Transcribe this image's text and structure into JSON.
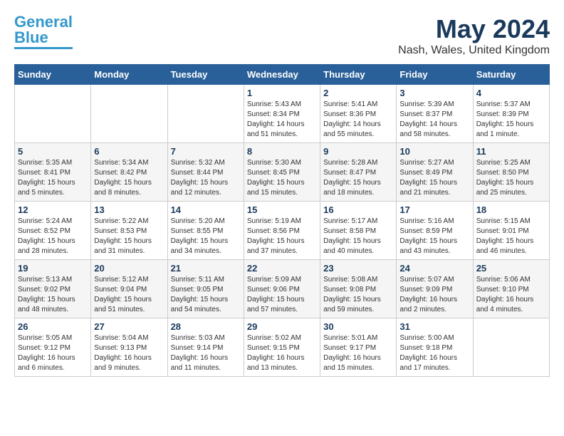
{
  "header": {
    "logo_general": "General",
    "logo_blue": "Blue",
    "month_year": "May 2024",
    "location": "Nash, Wales, United Kingdom"
  },
  "weekdays": [
    "Sunday",
    "Monday",
    "Tuesday",
    "Wednesday",
    "Thursday",
    "Friday",
    "Saturday"
  ],
  "weeks": [
    [
      {
        "day": "",
        "info": ""
      },
      {
        "day": "",
        "info": ""
      },
      {
        "day": "",
        "info": ""
      },
      {
        "day": "1",
        "info": "Sunrise: 5:43 AM\nSunset: 8:34 PM\nDaylight: 14 hours\nand 51 minutes."
      },
      {
        "day": "2",
        "info": "Sunrise: 5:41 AM\nSunset: 8:36 PM\nDaylight: 14 hours\nand 55 minutes."
      },
      {
        "day": "3",
        "info": "Sunrise: 5:39 AM\nSunset: 8:37 PM\nDaylight: 14 hours\nand 58 minutes."
      },
      {
        "day": "4",
        "info": "Sunrise: 5:37 AM\nSunset: 8:39 PM\nDaylight: 15 hours\nand 1 minute."
      }
    ],
    [
      {
        "day": "5",
        "info": "Sunrise: 5:35 AM\nSunset: 8:41 PM\nDaylight: 15 hours\nand 5 minutes."
      },
      {
        "day": "6",
        "info": "Sunrise: 5:34 AM\nSunset: 8:42 PM\nDaylight: 15 hours\nand 8 minutes."
      },
      {
        "day": "7",
        "info": "Sunrise: 5:32 AM\nSunset: 8:44 PM\nDaylight: 15 hours\nand 12 minutes."
      },
      {
        "day": "8",
        "info": "Sunrise: 5:30 AM\nSunset: 8:45 PM\nDaylight: 15 hours\nand 15 minutes."
      },
      {
        "day": "9",
        "info": "Sunrise: 5:28 AM\nSunset: 8:47 PM\nDaylight: 15 hours\nand 18 minutes."
      },
      {
        "day": "10",
        "info": "Sunrise: 5:27 AM\nSunset: 8:49 PM\nDaylight: 15 hours\nand 21 minutes."
      },
      {
        "day": "11",
        "info": "Sunrise: 5:25 AM\nSunset: 8:50 PM\nDaylight: 15 hours\nand 25 minutes."
      }
    ],
    [
      {
        "day": "12",
        "info": "Sunrise: 5:24 AM\nSunset: 8:52 PM\nDaylight: 15 hours\nand 28 minutes."
      },
      {
        "day": "13",
        "info": "Sunrise: 5:22 AM\nSunset: 8:53 PM\nDaylight: 15 hours\nand 31 minutes."
      },
      {
        "day": "14",
        "info": "Sunrise: 5:20 AM\nSunset: 8:55 PM\nDaylight: 15 hours\nand 34 minutes."
      },
      {
        "day": "15",
        "info": "Sunrise: 5:19 AM\nSunset: 8:56 PM\nDaylight: 15 hours\nand 37 minutes."
      },
      {
        "day": "16",
        "info": "Sunrise: 5:17 AM\nSunset: 8:58 PM\nDaylight: 15 hours\nand 40 minutes."
      },
      {
        "day": "17",
        "info": "Sunrise: 5:16 AM\nSunset: 8:59 PM\nDaylight: 15 hours\nand 43 minutes."
      },
      {
        "day": "18",
        "info": "Sunrise: 5:15 AM\nSunset: 9:01 PM\nDaylight: 15 hours\nand 46 minutes."
      }
    ],
    [
      {
        "day": "19",
        "info": "Sunrise: 5:13 AM\nSunset: 9:02 PM\nDaylight: 15 hours\nand 48 minutes."
      },
      {
        "day": "20",
        "info": "Sunrise: 5:12 AM\nSunset: 9:04 PM\nDaylight: 15 hours\nand 51 minutes."
      },
      {
        "day": "21",
        "info": "Sunrise: 5:11 AM\nSunset: 9:05 PM\nDaylight: 15 hours\nand 54 minutes."
      },
      {
        "day": "22",
        "info": "Sunrise: 5:09 AM\nSunset: 9:06 PM\nDaylight: 15 hours\nand 57 minutes."
      },
      {
        "day": "23",
        "info": "Sunrise: 5:08 AM\nSunset: 9:08 PM\nDaylight: 15 hours\nand 59 minutes."
      },
      {
        "day": "24",
        "info": "Sunrise: 5:07 AM\nSunset: 9:09 PM\nDaylight: 16 hours\nand 2 minutes."
      },
      {
        "day": "25",
        "info": "Sunrise: 5:06 AM\nSunset: 9:10 PM\nDaylight: 16 hours\nand 4 minutes."
      }
    ],
    [
      {
        "day": "26",
        "info": "Sunrise: 5:05 AM\nSunset: 9:12 PM\nDaylight: 16 hours\nand 6 minutes."
      },
      {
        "day": "27",
        "info": "Sunrise: 5:04 AM\nSunset: 9:13 PM\nDaylight: 16 hours\nand 9 minutes."
      },
      {
        "day": "28",
        "info": "Sunrise: 5:03 AM\nSunset: 9:14 PM\nDaylight: 16 hours\nand 11 minutes."
      },
      {
        "day": "29",
        "info": "Sunrise: 5:02 AM\nSunset: 9:15 PM\nDaylight: 16 hours\nand 13 minutes."
      },
      {
        "day": "30",
        "info": "Sunrise: 5:01 AM\nSunset: 9:17 PM\nDaylight: 16 hours\nand 15 minutes."
      },
      {
        "day": "31",
        "info": "Sunrise: 5:00 AM\nSunset: 9:18 PM\nDaylight: 16 hours\nand 17 minutes."
      },
      {
        "day": "",
        "info": ""
      }
    ]
  ]
}
